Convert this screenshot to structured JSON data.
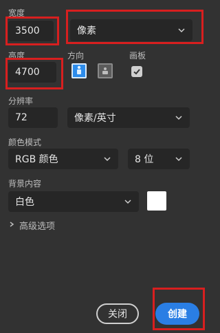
{
  "labels": {
    "width": "宽度",
    "height": "高度",
    "orientation": "方向",
    "artboard": "画板",
    "resolution": "分辨率",
    "color_mode": "颜色模式",
    "background": "背景内容",
    "advanced": "高级选项"
  },
  "fields": {
    "width_value": "3500",
    "height_value": "4700",
    "resolution_value": "72"
  },
  "selects": {
    "unit": "像素",
    "resolution_unit": "像素/英寸",
    "color_mode": "RGB 颜色",
    "bit_depth": "8 位",
    "background": "白色"
  },
  "buttons": {
    "close": "关闭",
    "create": "创建"
  },
  "colors": {
    "accent": "#2a7ee4",
    "highlight": "#d81f1f",
    "swatch": "#ffffff"
  },
  "icons": {
    "chevron": "chevron-down-icon",
    "advanced_chevron": "chevron-right-icon",
    "portrait": "portrait-orientation-icon",
    "landscape": "landscape-orientation-icon",
    "checkbox": "checkmark-icon"
  }
}
